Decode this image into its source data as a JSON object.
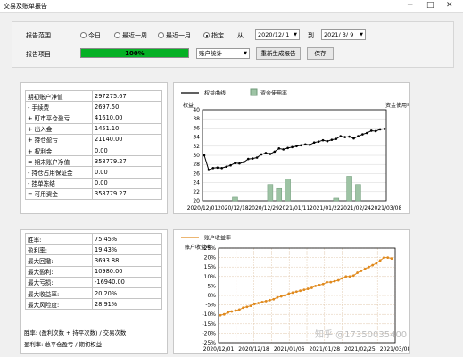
{
  "window": {
    "title": "交易及账单报告",
    "btn_min": "─",
    "btn_max": "□",
    "btn_close": "✕"
  },
  "toolbar": {
    "range_label": "报告范围",
    "range_options": [
      "今日",
      "最近一周",
      "最近一月",
      "指定"
    ],
    "from_label": "从",
    "to_label": "到",
    "from_date": "2020/12/ 1",
    "to_date": "2021/ 3/ 9",
    "item_label": "报告项目",
    "progress_text": "100%",
    "progress_value": 1.0,
    "select_value": "账户统计",
    "regen_button": "重新生成报告",
    "save_button": "保存"
  },
  "stats1": [
    {
      "label": "期初账户净值",
      "value": "297275.67"
    },
    {
      "label": "- 手续费",
      "value": "2697.50"
    },
    {
      "label": "+ 盯市平仓盈亏",
      "value": "41610.00"
    },
    {
      "label": "+ 出入金",
      "value": "1451.10"
    },
    {
      "label": "+ 持仓盈亏",
      "value": "21140.00"
    },
    {
      "label": "+ 权利金",
      "value": "0.00"
    },
    {
      "label": "= 期末账户净值",
      "value": "358779.27"
    },
    {
      "label": "- 持仓占用保证金",
      "value": "0.00"
    },
    {
      "label": "- 挂单冻结",
      "value": "0.00"
    },
    {
      "label": "= 可用资金",
      "value": "358779.27"
    }
  ],
  "stats2": [
    {
      "label": "胜率:",
      "value": "75.45%"
    },
    {
      "label": "盈利率:",
      "value": "19.43%"
    },
    {
      "label": "最大回撤:",
      "value": "3693.88"
    },
    {
      "label": "最大盈利:",
      "value": "10980.00"
    },
    {
      "label": "最大亏损:",
      "value": "-16940.00"
    },
    {
      "label": "最大收益率:",
      "value": "20.20%"
    },
    {
      "label": "最大风险度:",
      "value": "28.91%"
    }
  ],
  "notes": [
    "胜率: (盈利次数 + 持平次数) / 交易次数",
    "盈利率: 总平仓盈亏 / 期初权益"
  ],
  "watermark": "知乎 @17350035400",
  "icons": {
    "radio_on": "radio-checked",
    "dropdown": "chevron-down"
  },
  "chart_data": [
    {
      "type": "line",
      "legend": [
        "权益曲线",
        "资金使用率"
      ],
      "ylabel": "权益",
      "y2label": "资金使用率",
      "ylim": [
        20,
        40
      ],
      "yticks": [
        20,
        22,
        24,
        26,
        28,
        30,
        32,
        34,
        36,
        38,
        40
      ],
      "x_ticks": [
        "2020/12/01",
        "2020/12/18",
        "2020/12/29",
        "2021/01/11",
        "2021/01/22",
        "2021/02/24",
        "2021/03/08"
      ],
      "line_values": [
        30,
        26.8,
        27.2,
        27.3,
        27.2,
        27.5,
        27.8,
        28.3,
        28.2,
        28.5,
        29.2,
        29.3,
        29.5,
        30.2,
        30.5,
        30.3,
        30.8,
        31.5,
        31.3,
        31.6,
        31.8,
        32.0,
        32.2,
        32.4,
        32.3,
        32.8,
        33.0,
        33.3,
        33.1,
        33.4,
        33.6,
        34.2,
        34.0,
        34.1,
        33.7,
        34.2,
        34.6,
        34.9,
        35.4,
        35.3,
        35.7,
        35.8
      ],
      "bar_series_name": "资金使用率",
      "bars": [
        {
          "i": 7,
          "v": 20.8
        },
        {
          "i": 15,
          "v": 23.6
        },
        {
          "i": 17,
          "v": 22.7
        },
        {
          "i": 19,
          "v": 24.8
        },
        {
          "i": 30,
          "v": 20.6
        },
        {
          "i": 33,
          "v": 25.4
        },
        {
          "i": 35,
          "v": 23.6
        }
      ]
    },
    {
      "type": "line",
      "legend": [
        "账户收益率"
      ],
      "ylabel": "账户收益率",
      "ylim": [
        -25,
        25
      ],
      "yticks": [
        "25%",
        "20%",
        "15%",
        "10%",
        "5%",
        "0%",
        "-5%",
        "-10%",
        "-15%",
        "-20%",
        "-25%"
      ],
      "x_ticks": [
        "2020/12/01",
        "2020/12/18",
        "2021/01/06",
        "2021/01/28",
        "2021/02/25",
        "2021/03/08"
      ],
      "values": [
        -10.5,
        -10,
        -9,
        -8.5,
        -8,
        -7.5,
        -6.5,
        -6,
        -5.5,
        -4.5,
        -4,
        -3.5,
        -3,
        -2.5,
        -2,
        -1,
        -0.5,
        0,
        1,
        1.5,
        2,
        2.5,
        3,
        3.5,
        4,
        5,
        5.5,
        6,
        7,
        7,
        7.5,
        8,
        9,
        10,
        10,
        10.5,
        12,
        13,
        14,
        15,
        16,
        17,
        18.5,
        20,
        20,
        19.5
      ]
    }
  ]
}
